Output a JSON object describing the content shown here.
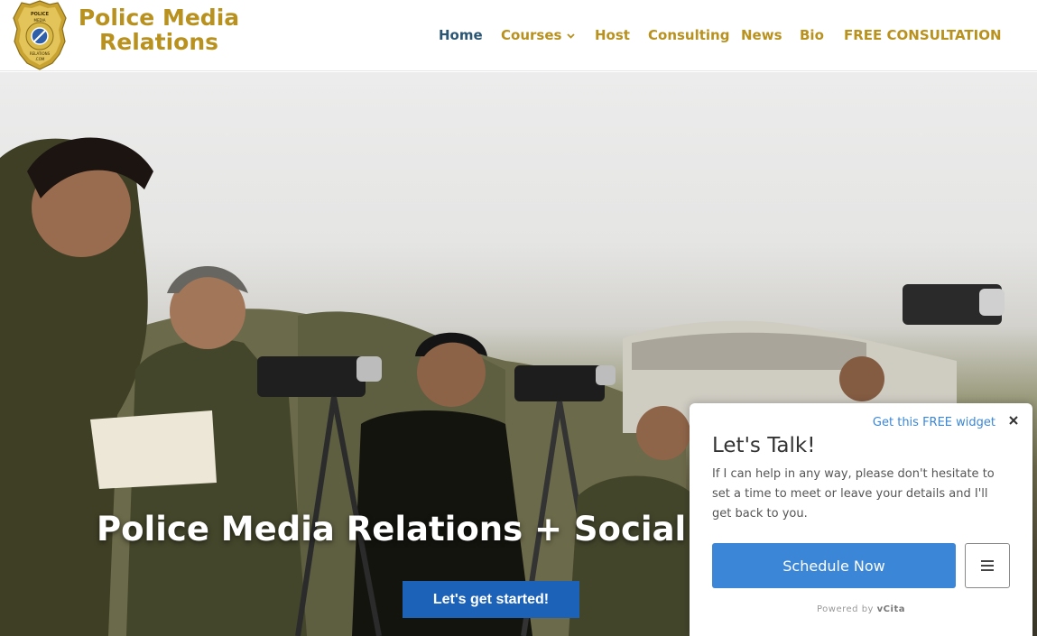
{
  "header": {
    "logo_badge_text": [
      "POLICE",
      "MEDIA",
      "RELATIONS",
      ".COM"
    ],
    "logo_line1": "Police Media",
    "logo_line2": "Relations"
  },
  "nav": {
    "items": [
      {
        "label": "Home",
        "active": true
      },
      {
        "label": "Courses",
        "has_dropdown": true
      },
      {
        "label": "Host"
      },
      {
        "label": "Consulting"
      },
      {
        "label": "News"
      },
      {
        "label": "Bio"
      },
      {
        "label": "FREE CONSULTATION"
      }
    ]
  },
  "hero": {
    "title": "Police Media Relations + Social Me",
    "cta_label": "Let's get started!"
  },
  "widget": {
    "get_widget_label": "Get this FREE widget",
    "title": "Let's Talk!",
    "description": "If I can help in any way, please don't hesitate to set a time to meet or leave your details and I'll get back to you.",
    "schedule_label": "Schedule Now",
    "powered_prefix": "Powered by",
    "powered_brand": "vCita"
  },
  "colors": {
    "brand_gold": "#b8911f",
    "nav_active": "#2b5673",
    "cta_blue": "#1c62b8",
    "widget_blue": "#3b86d6"
  }
}
